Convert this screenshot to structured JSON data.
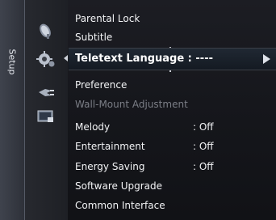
{
  "category": {
    "label": "Setup"
  },
  "category_icons": [
    {
      "icon": "satellite-dish-icon"
    },
    {
      "icon": "gear-setup-icon"
    },
    {
      "icon": "plug-input-icon"
    },
    {
      "icon": "application-icon"
    }
  ],
  "menu": {
    "items": [
      {
        "label": "Parental Lock",
        "value": "",
        "enabled": true
      },
      {
        "label": "Subtitle",
        "value": "",
        "enabled": true
      },
      {
        "label": "Preference",
        "value": "",
        "enabled": true
      },
      {
        "label": "Wall-Mount Adjustment",
        "value": "",
        "enabled": false
      },
      {
        "label": "Melody",
        "value": ": Off",
        "enabled": true
      },
      {
        "label": "Entertainment",
        "value": ": Off",
        "enabled": true
      },
      {
        "label": "Energy Saving",
        "value": ": Off",
        "enabled": true
      },
      {
        "label": "Software Upgrade",
        "value": "",
        "enabled": true
      },
      {
        "label": "Common Interface",
        "value": "",
        "enabled": true
      }
    ],
    "selected": {
      "label": "Teletext Language",
      "value": ": ----",
      "display": "Teletext Language  : ----"
    }
  },
  "colors": {
    "highlight": "#1a222c",
    "text": "#ffffff",
    "disabled": "#7b7e86"
  }
}
